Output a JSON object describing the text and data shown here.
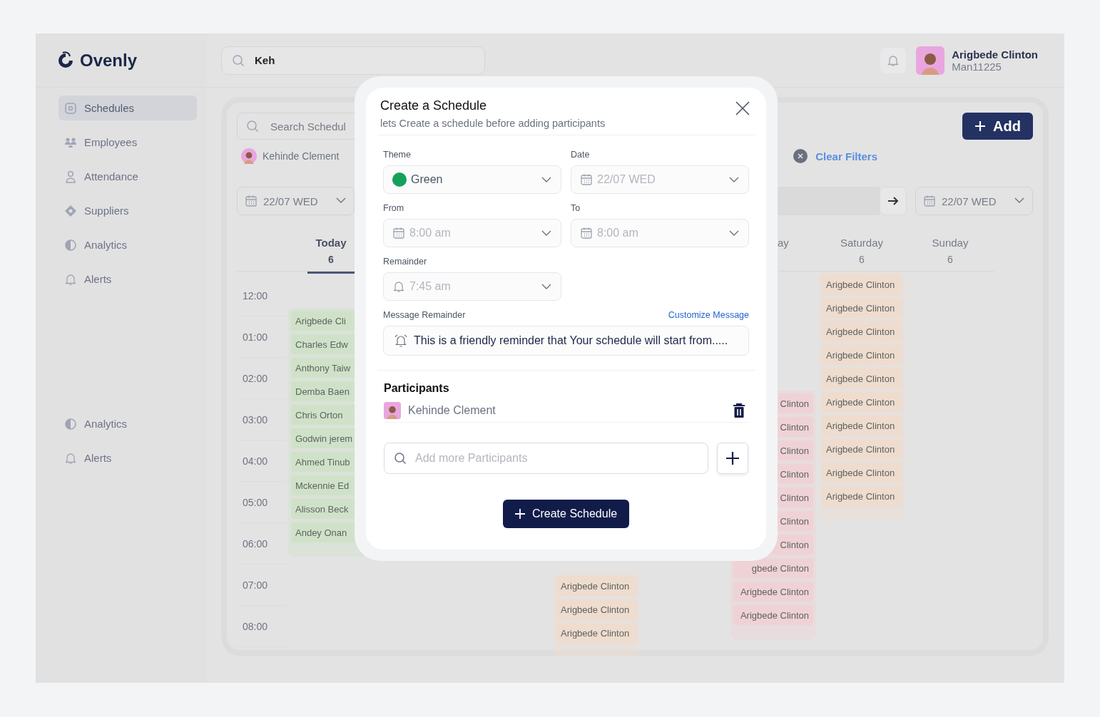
{
  "sidebar": {
    "logo": "Ovenly",
    "items": [
      {
        "label": "Schedules",
        "selected": true
      },
      {
        "label": "Employees",
        "selected": false
      },
      {
        "label": "Attendance",
        "selected": false
      },
      {
        "label": "Suppliers",
        "selected": false
      },
      {
        "label": "Analytics",
        "selected": false
      },
      {
        "label": "Alerts",
        "selected": false
      }
    ],
    "lower_items": [
      {
        "label": "Analytics",
        "selected": false
      },
      {
        "label": "Alerts",
        "selected": false
      }
    ]
  },
  "topbar": {
    "search": {
      "value": "Keh"
    },
    "user": {
      "name": "Arigbede Clinton",
      "id": "Man11225"
    }
  },
  "schedule_panel": {
    "search": {
      "placeholder": "Search Schedul"
    },
    "add_button": "Add",
    "filter_chip": "Kehinde Clement",
    "clear_filters": "Clear Filters",
    "date_pickers": [
      "22/07 WED",
      "22/07 WED"
    ],
    "times": [
      "12:00",
      "01:00",
      "02:00",
      "03:00",
      "04:00",
      "05:00",
      "06:00",
      "07:00",
      "08:00"
    ],
    "day_headers": [
      {
        "label": "Today",
        "date": "6",
        "selected": true
      },
      {
        "label": "ay",
        "selected": false
      },
      {
        "label": "Saturday",
        "date": "6",
        "selected": false
      },
      {
        "label": "Sunday",
        "date": "6",
        "selected": false
      }
    ],
    "event_columns": [
      {
        "color": "#cfe2c9",
        "entries": [
          "Arigbede Cli",
          "Charles Edw",
          "Anthony Taiw",
          "Demba Baen",
          "Chris Orton",
          "Godwin jerem",
          "Ahmed Tinub",
          "Mckennie Ed",
          "Alisson Beck",
          "Andey Onan"
        ]
      },
      {
        "color": "#eedccf",
        "entries": [
          "Arigbede Clinton",
          "Arigbede Clinton",
          "Arigbede Clinton"
        ]
      },
      {
        "color": "#efd2d6",
        "entries": [
          "Clinton",
          "Clinton",
          "Clinton",
          "Clinton",
          "Clinton",
          "Clinton",
          "Clinton",
          "gbede Clinton",
          "Arigbede Clinton",
          "Arigbede Clinton"
        ]
      },
      {
        "color": "#eedccf",
        "entries": [
          "Arigbede Clinton",
          "Arigbede Clinton",
          "Arigbede Clinton",
          "Arigbede Clinton",
          "Arigbede Clinton",
          "Arigbede Clinton",
          "Arigbede Clinton",
          "Arigbede Clinton",
          "Arigbede Clinton",
          "Arigbede Clinton"
        ]
      }
    ]
  },
  "modal": {
    "title": "Create a Schedule",
    "subtitle": "lets Create a schedule before adding participants",
    "fields": [
      {
        "label": "Theme",
        "kind": "theme",
        "value": "Green"
      },
      {
        "label": "Date",
        "kind": "date",
        "placeholder": "22/07 WED"
      },
      {
        "label": "From",
        "kind": "date",
        "placeholder": "8:00 am"
      },
      {
        "label": "To",
        "kind": "date",
        "placeholder": "8:00 am"
      },
      {
        "label": "Remainder",
        "kind": "bell",
        "placeholder": "7:45 am"
      }
    ],
    "message": {
      "label": "Message Remainder",
      "link": "Customize Message",
      "value": "This is a friendly reminder that Your schedule will start from....."
    },
    "participants_title": "Participants",
    "participants": [
      {
        "name": "Kehinde Clement"
      }
    ],
    "add_participant": {
      "placeholder": "Add more Participants"
    },
    "submit": "Create Schedule"
  }
}
